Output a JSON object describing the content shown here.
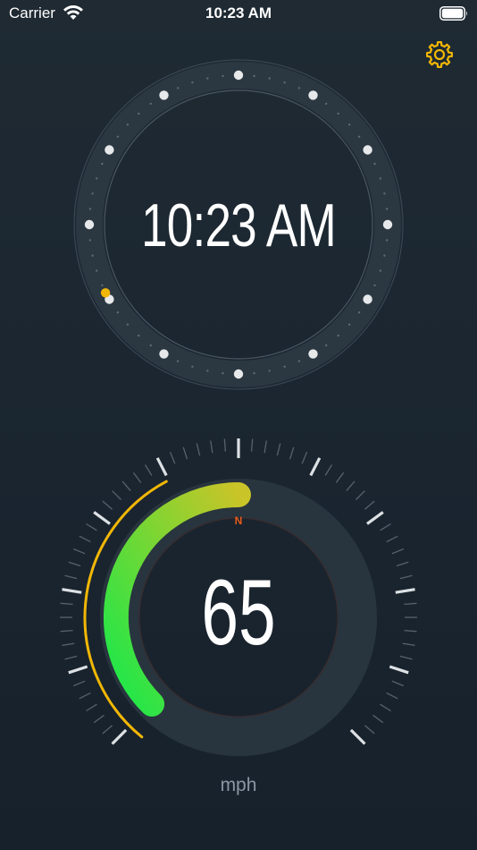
{
  "status_bar": {
    "carrier": "Carrier",
    "time": "10:23 AM"
  },
  "clock": {
    "time_display": "10:23 AM",
    "hour_marker_count": 12,
    "accent_color": "#f2b705"
  },
  "speedometer": {
    "speed": "65",
    "unit": "mph",
    "compass_heading": "N",
    "gauge_fraction": 0.5,
    "gradient_start_color": "#19e84b",
    "gradient_end_color": "#c9c428",
    "outer_arc_color": "#f2b705"
  },
  "settings": {
    "icon": "gear-icon",
    "color": "#f2b705"
  }
}
